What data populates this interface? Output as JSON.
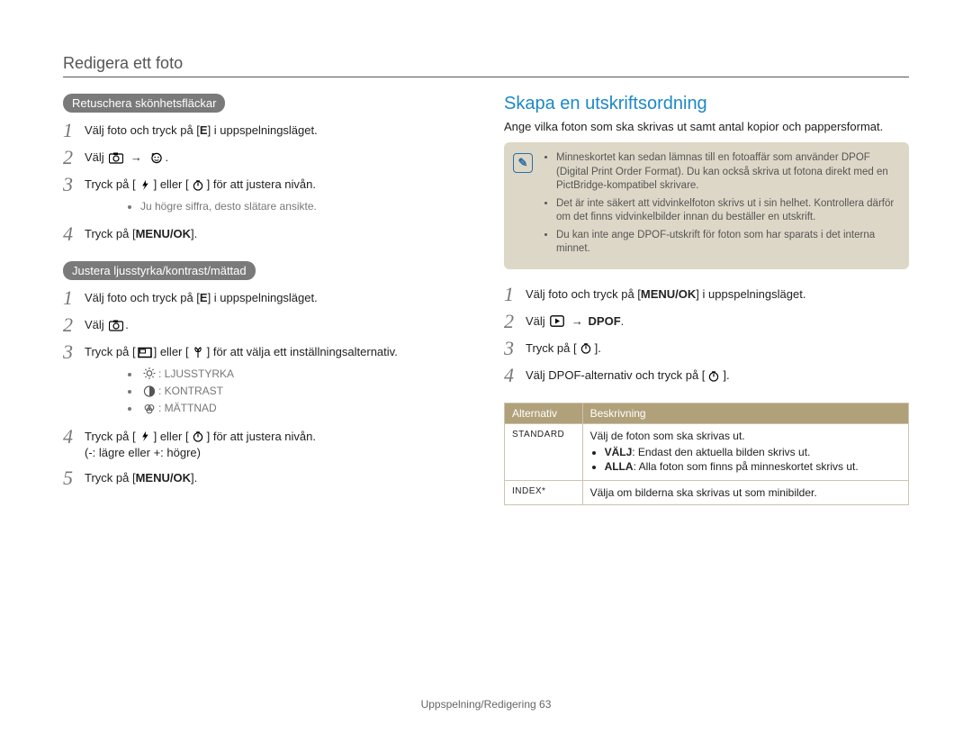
{
  "page_title": "Redigera ett foto",
  "left": {
    "section_a": {
      "pill": "Retuschera skönhetsfläckar",
      "steps": [
        {
          "n": "1",
          "html": "Välj foto och tryck på [<b>E</b>] i uppspelningsläget."
        },
        {
          "n": "2",
          "html": "Välj {PHOTO} → {FACE}."
        },
        {
          "n": "3",
          "html": "Tryck på [{FLASH}] eller [{TIMER}] för att justera nivån.",
          "sub": [
            "Ju högre siffra, desto slätare ansikte."
          ]
        },
        {
          "n": "4",
          "html": "Tryck på [<b>MENU/OK</b>]."
        }
      ]
    },
    "section_b": {
      "pill": "Justera ljusstyrka/kontrast/mättad",
      "steps": [
        {
          "n": "1",
          "html": "Välj foto och tryck på [<b>E</b>] i uppspelningsläget."
        },
        {
          "n": "2",
          "html": "Välj {PHOTO}."
        },
        {
          "n": "3",
          "html": "Tryck på [{DISP}] eller [{MACRO}] för att välja ett inställningsalternativ.",
          "sub": [
            "{SUN}: LJUSSTYRKA",
            "{CONTRAST}: KONTRAST",
            "{SAT}: MÄTTNAD"
          ]
        },
        {
          "n": "4",
          "html": "Tryck på [{FLASH}] eller [{TIMER}] för att justera nivån.<br>(-: lägre eller +: högre)"
        },
        {
          "n": "5",
          "html": "Tryck på [<b>MENU/OK</b>]."
        }
      ]
    }
  },
  "right": {
    "title": "Skapa en utskriftsordning",
    "intro": "Ange vilka foton som ska skrivas ut samt antal kopior och pappersformat.",
    "notes": [
      "Minneskortet kan sedan lämnas till en fotoaffär som använder DPOF (Digital Print Order Format). Du kan också skriva ut fotona direkt med en PictBridge-kompatibel skrivare.",
      "Det är inte säkert att vidvinkelfoton skrivs ut i sin helhet. Kontrollera därför om det finns vidvinkelbilder innan du beställer en utskrift.",
      "Du kan inte ange DPOF-utskrift för foton som har sparats i det interna minnet."
    ],
    "steps": [
      {
        "n": "1",
        "html": "Välj foto och tryck på [<b>MENU/OK</b>] i uppspelningsläget."
      },
      {
        "n": "2",
        "html": "Välj {PLAY} → <b>DPOF</b>."
      },
      {
        "n": "3",
        "html": "Tryck på [{TIMER}]."
      },
      {
        "n": "4",
        "html": "Välj DPOF-alternativ och tryck på [{TIMER}]."
      }
    ],
    "table": {
      "headers": [
        "Alternativ",
        "Beskrivning"
      ],
      "rows": [
        {
          "k": "STANDARD",
          "desc_lead": "Välj de foton som ska skrivas ut.",
          "items": [
            "<b>VÄLJ</b>: Endast den aktuella bilden skrivs ut.",
            "<b>ALLA</b>: Alla foton som finns på minneskortet skrivs ut."
          ]
        },
        {
          "k": "INDEX*",
          "desc_lead": "Välja om bilderna ska skrivas ut som minibilder.",
          "items": []
        }
      ]
    }
  },
  "footer": {
    "section": "Uppspelning/Redigering",
    "page": "63"
  }
}
